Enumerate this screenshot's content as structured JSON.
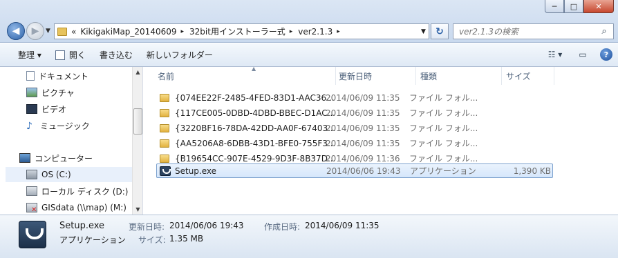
{
  "window": {
    "minimize_label": "─",
    "maximize_label": "□",
    "close_label": "✕"
  },
  "address": {
    "overflow": "«",
    "segments": [
      "KikigakiMap_20140609",
      "32bit用インストーラー式",
      "ver2.1.3"
    ],
    "separator": "▸"
  },
  "search": {
    "placeholder": "ver2.1.3の検索"
  },
  "toolbar": {
    "organize": "整理 ▾",
    "open": "開く",
    "burn": "書き込む",
    "new_folder": "新しいフォルダー"
  },
  "nav": {
    "items": [
      {
        "label": "ドキュメント",
        "icon": "document-icon"
      },
      {
        "label": "ピクチャ",
        "icon": "picture-icon"
      },
      {
        "label": "ビデオ",
        "icon": "video-icon"
      },
      {
        "label": "ミュージック",
        "icon": "music-icon"
      },
      {
        "label": "コンピューター",
        "icon": "computer-icon"
      },
      {
        "label": "OS (C:)",
        "icon": "drive-icon"
      },
      {
        "label": "ローカル ディスク (D:)",
        "icon": "drive-icon"
      },
      {
        "label": "GISdata (\\\\map) (M:)",
        "icon": "network-drive-icon"
      }
    ]
  },
  "columns": {
    "name": "名前",
    "date": "更新日時",
    "type": "種類",
    "size": "サイズ"
  },
  "files": [
    {
      "name": "{074EE22F-2485-4FED-83D1-AAC36...",
      "date": "2014/06/09 11:35",
      "type": "ファイル フォル...",
      "size": ""
    },
    {
      "name": "{117CE005-0DBD-4DBD-BBEC-D1AC...",
      "date": "2014/06/09 11:35",
      "type": "ファイル フォル...",
      "size": ""
    },
    {
      "name": "{3220BF16-78DA-42DD-AA0F-67403...",
      "date": "2014/06/09 11:35",
      "type": "ファイル フォル...",
      "size": ""
    },
    {
      "name": "{AA5206A8-6DBB-43D1-BFE0-755F3...",
      "date": "2014/06/09 11:35",
      "type": "ファイル フォル...",
      "size": ""
    },
    {
      "name": "{B19654CC-907E-4529-9D3F-8B37D...",
      "date": "2014/06/09 11:36",
      "type": "ファイル フォル...",
      "size": ""
    },
    {
      "name": "Setup.exe",
      "date": "2014/06/06 19:43",
      "type": "アプリケーション",
      "size": "1,390 KB"
    }
  ],
  "details": {
    "filename": "Setup.exe",
    "type": "アプリケーション",
    "modified_label": "更新日時:",
    "modified_value": "2014/06/06 19:43",
    "created_label": "作成日時:",
    "created_value": "2014/06/09 11:35",
    "size_label": "サイズ:",
    "size_value": "1.35 MB"
  }
}
